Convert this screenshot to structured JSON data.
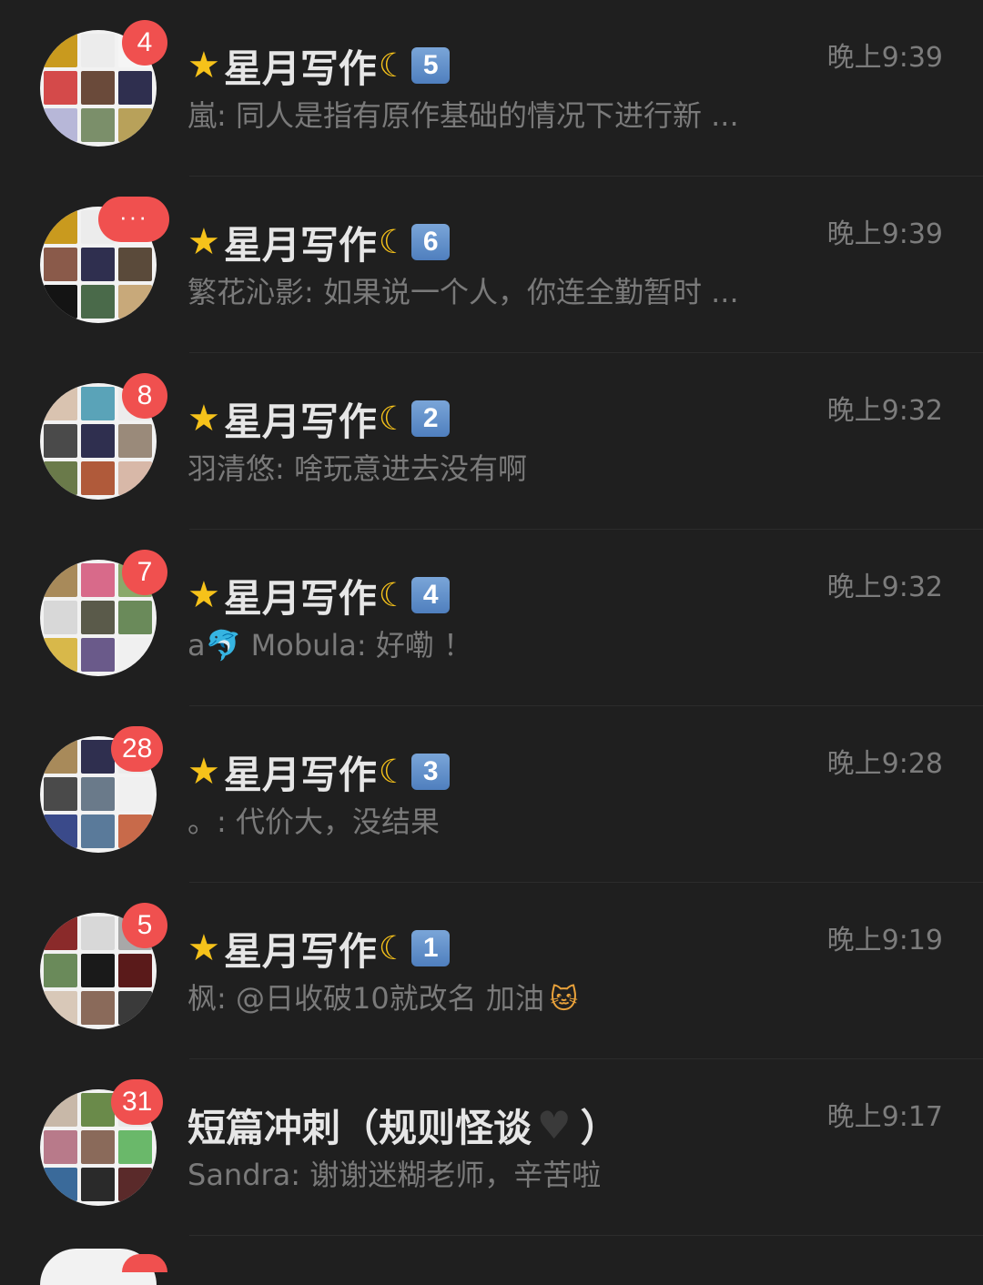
{
  "chats": [
    {
      "title": "星月写作",
      "title_prefix_icon": "star-emoji",
      "title_suffix_icon": "crescent-moon-emoji",
      "title_number": "5",
      "preview": "嵐: 同人是指有原作基础的情况下进行新 ...",
      "time": "晚上9:39",
      "badge": "4",
      "tiles": [
        "#c99a1e",
        "#ececec",
        "#f5f5f5",
        "#d44a4a",
        "#6a4a3a",
        "#2f2f4f",
        "#b7b7d8",
        "#7b8f6a",
        "#b8a15a"
      ]
    },
    {
      "title": "星月写作",
      "title_prefix_icon": "star-emoji",
      "title_suffix_icon": "crescent-moon-emoji",
      "title_number": "6",
      "preview": "繁花沁影: 如果说一个人，你连全勤暂时 ...",
      "time": "晚上9:39",
      "badge": "···",
      "tiles": [
        "#c99a1e",
        "#ececec",
        "#f5f5f5",
        "#8a5a4a",
        "#2f2f4f",
        "#5a4a3a",
        "#141414",
        "#4a6a4a",
        "#c8a97a"
      ]
    },
    {
      "title": "星月写作",
      "title_prefix_icon": "star-emoji",
      "title_suffix_icon": "crescent-moon-emoji",
      "title_number": "2",
      "preview": "羽清悠: 啥玩意进去没有啊",
      "time": "晚上9:32",
      "badge": "8",
      "tiles": [
        "#d9c3b0",
        "#5aa3b8",
        "#ececec",
        "#4a4a4a",
        "#2f2f4f",
        "#9a8a7a",
        "#6a7a4a",
        "#b05a3a",
        "#d8b8a8"
      ]
    },
    {
      "title": "星月写作",
      "title_prefix_icon": "star-emoji",
      "title_suffix_icon": "crescent-moon-emoji",
      "title_number": "4",
      "preview": "a🐬 Mobula: 好嘞 ！",
      "time": "晚上9:32",
      "badge": "7",
      "tiles": [
        "#a88a5a",
        "#d86a8a",
        "#8aa86a",
        "#d8d8d8",
        "#5a5a4a",
        "#6a8a5a",
        "#d8b84a",
        "#6a5a8a",
        "#f0f0f0"
      ]
    },
    {
      "title": "星月写作",
      "title_prefix_icon": "star-emoji",
      "title_suffix_icon": "crescent-moon-emoji",
      "title_number": "3",
      "preview": "。: 代价大，没结果",
      "time": "晚上9:28",
      "badge": "28",
      "tiles": [
        "#a88a5a",
        "#2f2f4f",
        "#ececec",
        "#4a4a4a",
        "#6a7a8a",
        "#f0f0f0",
        "#3a4a8a",
        "#5a7a9a",
        "#c86a4a"
      ]
    },
    {
      "title": "星月写作",
      "title_prefix_icon": "star-emoji",
      "title_suffix_icon": "crescent-moon-emoji",
      "title_number": "1",
      "preview": "枫: @日收破10就改名 加油",
      "preview_tail_icon": "cat-face-emoji",
      "time": "晚上9:19",
      "badge": "5",
      "tiles": [
        "#8a2a2a",
        "#d8d8d8",
        "#a8a8a8",
        "#6a8a5a",
        "#1a1a1a",
        "#5a1a1a",
        "#d8c8b8",
        "#8a6a5a",
        "#3a3a3a"
      ]
    },
    {
      "title": "短篇冲刺（规则怪谈",
      "title_suffix_text": "）",
      "title_heart_icon": "black-heart-emoji",
      "preview": "Sandra: 谢谢迷糊老师，辛苦啦",
      "time": "晚上9:17",
      "badge": "31",
      "tiles": [
        "#c8b8a8",
        "#6a8a4a",
        "#e8e8e8",
        "#b87a8a",
        "#8a6a5a",
        "#6ab86a",
        "#3a6a9a",
        "#2a2a2a",
        "#5a2a2a"
      ]
    }
  ]
}
